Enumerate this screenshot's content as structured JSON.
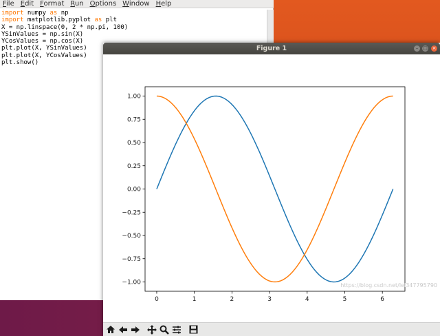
{
  "editor": {
    "menu": [
      "File",
      "Edit",
      "Format",
      "Run",
      "Options",
      "Window",
      "Help"
    ],
    "code_lines": [
      [
        {
          "t": "import",
          "kw": true
        },
        {
          "t": " numpy ",
          "kw": false
        },
        {
          "t": "as",
          "kw": true
        },
        {
          "t": " np",
          "kw": false
        }
      ],
      [
        {
          "t": "import",
          "kw": true
        },
        {
          "t": " matplotlib.pyplot ",
          "kw": false
        },
        {
          "t": "as",
          "kw": true
        },
        {
          "t": " plt",
          "kw": false
        }
      ],
      [
        {
          "t": "X = np.linspace(0, 2 * np.pi, 100)",
          "kw": false
        }
      ],
      [
        {
          "t": "YSinValues = np.sin(X)",
          "kw": false
        }
      ],
      [
        {
          "t": "YCosValues = np.cos(X)",
          "kw": false
        }
      ],
      [
        {
          "t": "plt.plot(X, YSinValues)",
          "kw": false
        }
      ],
      [
        {
          "t": "plt.plot(X, YCosValues)",
          "kw": false
        }
      ],
      [
        {
          "t": "plt.show()",
          "kw": false
        }
      ]
    ]
  },
  "figure": {
    "title": "Figure 1",
    "toolbar": [
      "home-icon",
      "back-arrow-icon",
      "forward-arrow-icon",
      "pan-icon",
      "zoom-icon",
      "configure-subplots-icon",
      "save-icon"
    ]
  },
  "watermark": "https://blog.csdn.net/lei347795790",
  "chart_data": {
    "type": "line",
    "xlim": [
      -0.31,
      6.6
    ],
    "ylim": [
      -1.1,
      1.1
    ],
    "xticks": [
      0,
      1,
      2,
      3,
      4,
      5,
      6
    ],
    "yticks": [
      1.0,
      0.75,
      0.5,
      0.25,
      0.0,
      -0.25,
      -0.5,
      -0.75,
      -1.0
    ],
    "ytick_labels": [
      "1.00",
      "0.75",
      "0.50",
      "0.25",
      "0.00",
      "−0.25",
      "−0.50",
      "−0.75",
      "−1.00"
    ],
    "grid": false,
    "x": {
      "start": 0,
      "end": 6.283185,
      "count": 100
    },
    "series": [
      {
        "function": "sin",
        "color": "#1f77b4"
      },
      {
        "function": "cos",
        "color": "#ff7f0e"
      }
    ]
  }
}
